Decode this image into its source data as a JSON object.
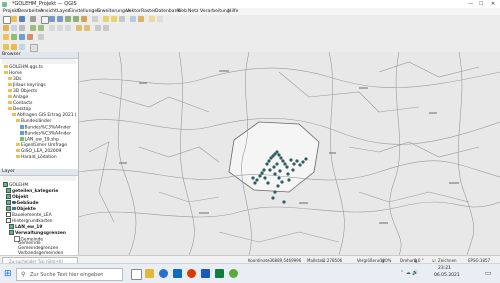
{
  "window": {
    "title": "*GOLEHM_Projekt — QGIS"
  },
  "menu": [
    "Projekt",
    "Bearbeiten",
    "Ansicht",
    "Layer",
    "Einstellungen",
    "Erweiterungen",
    "Vektor",
    "Raster",
    "Datenbank",
    "Web",
    "Netz",
    "Verarbeitung",
    "Hilfe"
  ],
  "browser": {
    "title": "Browser",
    "items": [
      "GOLEHM.qgs.ts",
      "Home",
      "3Ds",
      "Jillaus keyrings",
      "3D Objects",
      "Anlage",
      "Contacts",
      "Desktop",
      "Abfragen GIS Ertrag 2021 (",
      "Bundesländer",
      "Bundes%C3%A4nder",
      "Bundes%C3%A4nder",
      "LAN_ew_19.shp",
      "Eigentümer Umfrage",
      "GISO_LEA_202009",
      "Harald_Lödation"
    ]
  },
  "layers": {
    "title": "Layer",
    "items": [
      "GOLEHM",
      "geteilen_kategorie",
      "Objekt",
      "Gebäude",
      "Objekte",
      "Bauelemente_LEA",
      "Hintergrundkarten",
      "LAN_ew_19",
      "Verwaltungsgrenzen",
      "Gemeinde",
      "Gemeinde",
      "Gemeindegrenzen",
      "Verbandsgemeinden"
    ]
  },
  "status": {
    "search_placeholder": "Zu suchender Typ (Strg+K)",
    "coord_label": "Koordinate",
    "coord_value": "-36889,5469996",
    "scale_label": "Maßstab",
    "scale_value": "1:278506",
    "magnifier_label": "Vergrößerung",
    "magnifier_value": "100%",
    "rotation_label": "Drehung",
    "rotation_value": "0,0 °",
    "render_label": "Zeichnen",
    "epsg": "EPSG:3857"
  },
  "taskbar": {
    "search_placeholder": "Zur Suche Text hier eingeben",
    "time": "23:21",
    "date": "06.05.2021"
  },
  "colors": {
    "points": "#2f5d63",
    "admin_lines": "#9a9a9a",
    "highlight_fill": "#e0e0e0"
  }
}
